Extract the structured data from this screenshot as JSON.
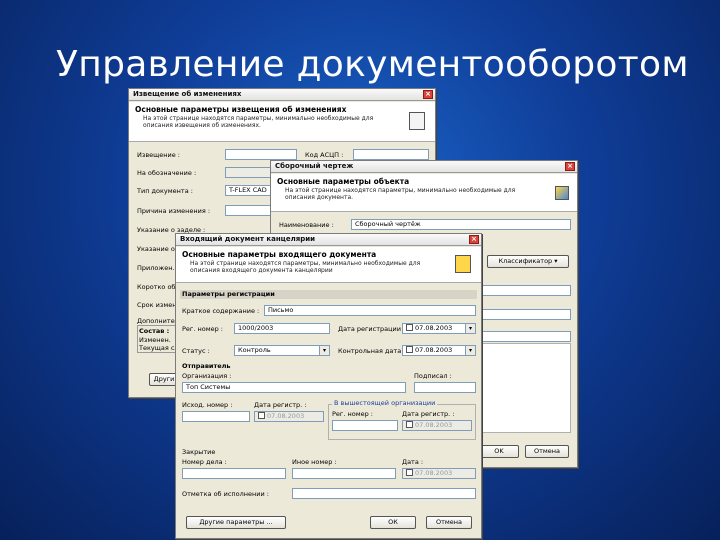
{
  "slide": {
    "title": "Управление документооборотом"
  },
  "w1": {
    "title": "Извещение об изменениях",
    "heading": "Основные параметры извещения об изменениях",
    "desc": "На этой странице находятся параметры, минимально необходимые для описания извещения об изменениях.",
    "labels": {
      "notice": "Извещение :",
      "code": "Код АСЦП :",
      "designation": "На обозначение :",
      "doctype": "Тип документа :",
      "reason": "Причина изменения :",
      "instruction": "Указание о заделе :",
      "instruction2": "Указание о внедр.",
      "appendix": "Приложен.",
      "brief": "Коротко об",
      "deadline": "Срок измене.",
      "extra": "Дополнител.",
      "composition": "Состав :",
      "changed": "Изменен.",
      "current": "Текущая сл."
    },
    "doctype_value": "T-FLEX CAD",
    "bottom_btn": "Други"
  },
  "w2": {
    "title": "Сборочный чертеж",
    "heading": "Основные параметры объекта",
    "desc": "На этой странице находятся параметры, минимально необходимые для описания документа.",
    "name_label": "Наименование :",
    "name_value": "Сборочный чертёж",
    "classifier_btn": "Классификатор",
    "ok": "OK",
    "cancel": "Отмена"
  },
  "w3": {
    "title": "Входящий документ канцелярии",
    "heading": "Основные параметры входящего документа",
    "desc": "На этой странице находятся параметры, минимально необходимые для описания входящего документа канцелярии",
    "reg_section": "Параметры регистрации",
    "brief_label": "Краткое содержание :",
    "brief_value": "Письмо",
    "regnum_label": "Рег. номер :",
    "regnum_value": "1000/2003",
    "regdate_label": "Дата регистрации :",
    "regdate_value": "07.08.2003",
    "status_label": "Статус :",
    "status_value": "Контроль",
    "control_label": "Контрольная дата :",
    "control_value": "07.08.2003",
    "sender_section": "Отправитель",
    "org_label": "Организация :",
    "org_value": "Топ Системы",
    "signed_label": "Подписал :",
    "outnum_label": "Исход. номер :",
    "outdate_label": "Дата регистр. :",
    "outdate_value": "07.08.2003",
    "higher_group": "В вышестоящей организации",
    "hreg_label": "Рег. номер :",
    "hdate_label": "Дата регистр. :",
    "hdate_value": "07.08.2003",
    "closing_label": "Закрытие",
    "case_label": "Номер дела :",
    "other_label": "Иное номер :",
    "date_label": "Дата :",
    "date_value": "07.08.2003",
    "exec_label": "Отметка об исполнении :",
    "other_params_btn": "Другие параметры ...",
    "ok": "ОК",
    "cancel": "Отмена"
  }
}
